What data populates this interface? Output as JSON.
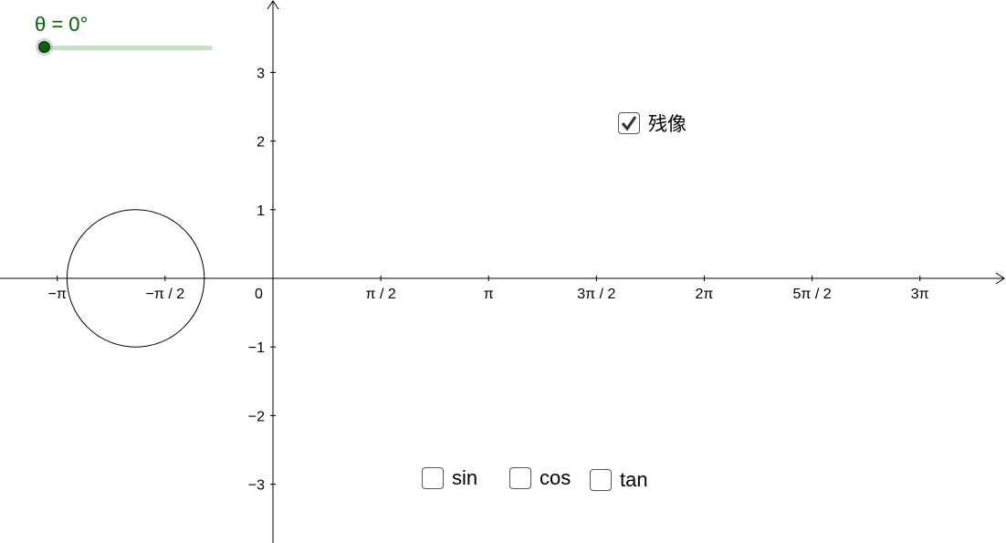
{
  "slider": {
    "label": "θ = 0°",
    "value_deg": 0,
    "color": "#006400"
  },
  "axes": {
    "x_ticks": [
      {
        "value_pi": -1,
        "label": "−π"
      },
      {
        "value_pi": -0.5,
        "label": "−π / 2"
      },
      {
        "value_pi": 0.5,
        "label": "π / 2"
      },
      {
        "value_pi": 1,
        "label": "π"
      },
      {
        "value_pi": 1.5,
        "label": "3π / 2"
      },
      {
        "value_pi": 2,
        "label": "2π"
      },
      {
        "value_pi": 2.5,
        "label": "5π / 2"
      },
      {
        "value_pi": 3,
        "label": "3π"
      }
    ],
    "y_ticks": [
      {
        "value": 3,
        "label": "3"
      },
      {
        "value": 2,
        "label": "2"
      },
      {
        "value": 1,
        "label": "1"
      },
      {
        "value": -1,
        "label": "−1"
      },
      {
        "value": -2,
        "label": "−2"
      },
      {
        "value": -3,
        "label": "−3"
      }
    ],
    "origin_label": "0"
  },
  "circle": {
    "center": [
      -2,
      0
    ],
    "radius": 1
  },
  "checkboxes": {
    "afterimage": {
      "label": "残像",
      "checked": true
    },
    "sin": {
      "label": "sin",
      "checked": false
    },
    "cos": {
      "label": "cos",
      "checked": false
    },
    "tan": {
      "label": "tan",
      "checked": false
    }
  }
}
